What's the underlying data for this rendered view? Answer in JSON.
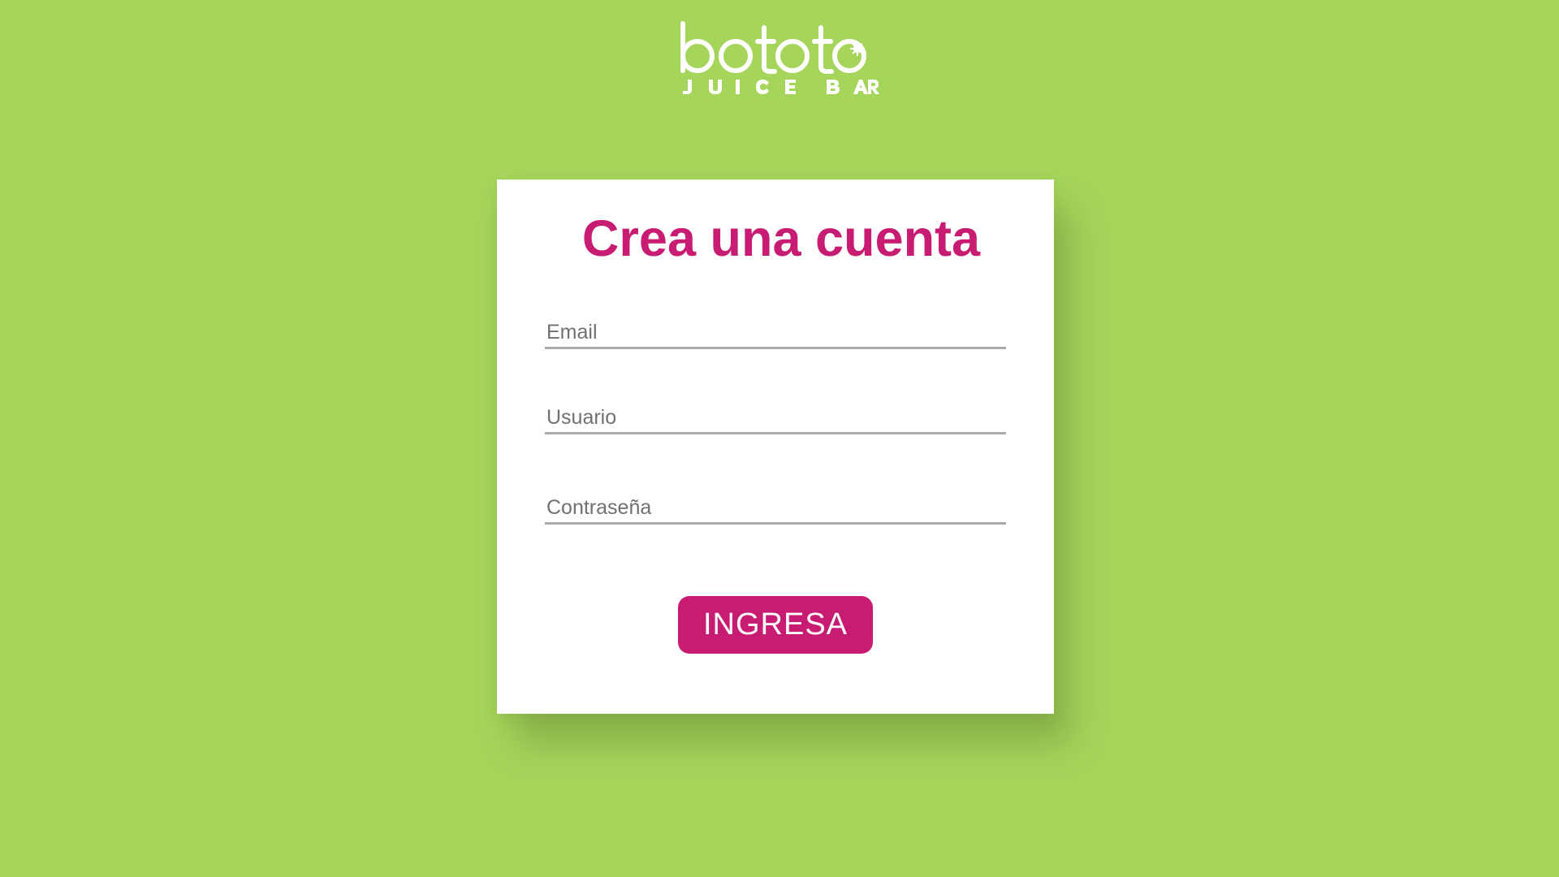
{
  "brand": {
    "name": "bototo",
    "tagline": "JUICE BAR"
  },
  "form": {
    "title": "Crea una cuenta",
    "email_placeholder": "Email",
    "user_placeholder": "Usuario",
    "password_placeholder": "Contraseña",
    "submit_label": "INGRESA"
  },
  "colors": {
    "background": "#a6d55c",
    "accent": "#c81c72",
    "card": "#ffffff",
    "field_underline": "#aaaaaa"
  }
}
